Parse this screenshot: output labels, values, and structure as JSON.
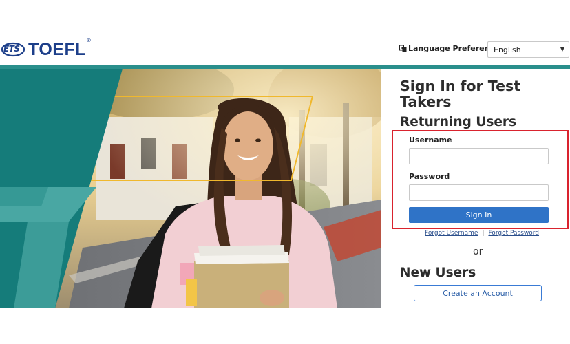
{
  "brand": {
    "ets": "ETS",
    "name": "TOEFL",
    "reg": "®"
  },
  "header": {
    "language_label": "Language Preference",
    "language_value": "English"
  },
  "signin": {
    "title": "Sign In for Test Takers",
    "returning_heading": "Returning Users",
    "username_label": "Username",
    "username_value": "",
    "password_label": "Password",
    "password_value": "",
    "submit_label": "Sign In",
    "forgot_username": "Forgot Username",
    "link_separator": "|",
    "forgot_password": "Forgot Password",
    "or_text": "or"
  },
  "new_users": {
    "heading": "New Users",
    "create_label": "Create an Account"
  },
  "colors": {
    "brand_blue": "#1d3f8a",
    "teal": "#2a8f8c",
    "button_blue": "#2f73c7",
    "highlight_red": "#d9232e"
  },
  "icons": {
    "language": "translate-icon",
    "dropdown": "chevron-down-icon"
  }
}
